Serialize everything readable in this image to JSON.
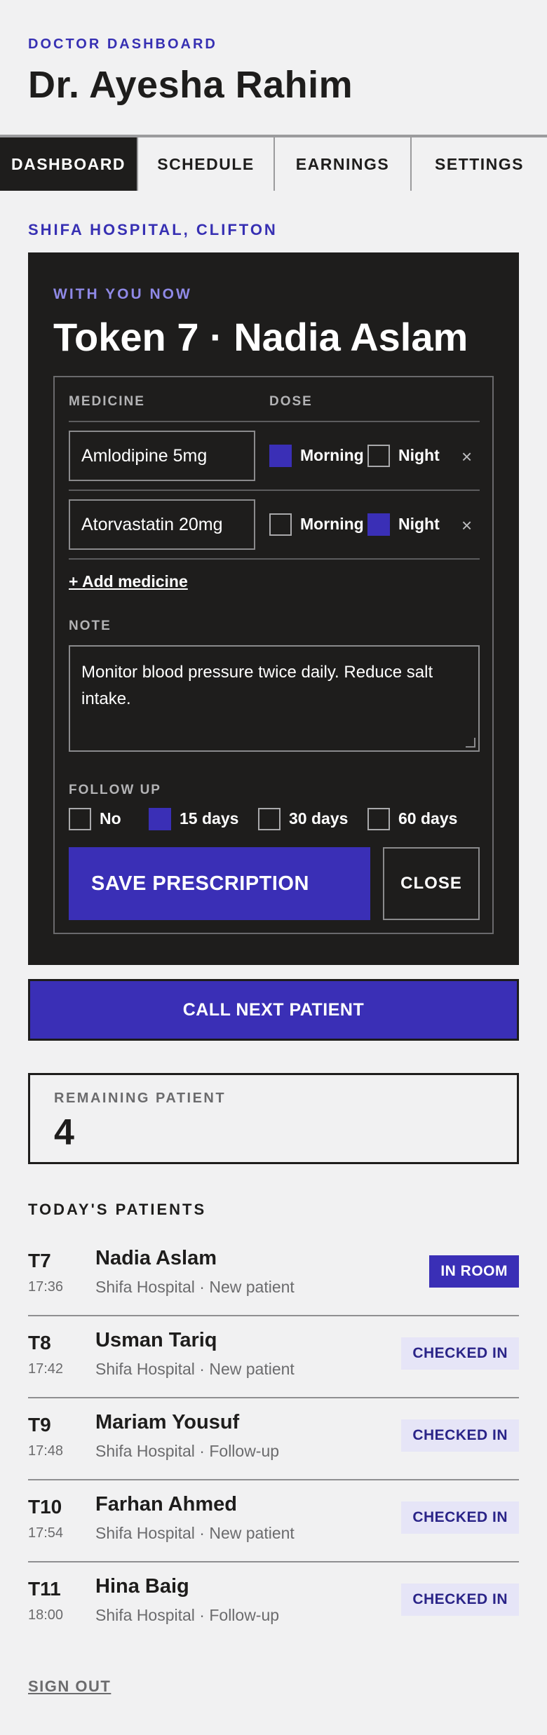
{
  "header": {
    "eyebrow": "DOCTOR DASHBOARD",
    "doctor_name": "Dr. Ayesha Rahim"
  },
  "tabs": [
    {
      "label": "DASHBOARD",
      "active": true
    },
    {
      "label": "SCHEDULE",
      "active": false
    },
    {
      "label": "EARNINGS",
      "active": false
    },
    {
      "label": "SETTINGS",
      "active": false
    }
  ],
  "hospital": "SHIFA HOSPITAL, CLIFTON",
  "consultation": {
    "eyebrow": "WITH YOU NOW",
    "title": "Token 7 · Nadia Aslam",
    "prescription": {
      "medicine_header": "MEDICINE",
      "dose_header": "DOSE",
      "medicines": [
        {
          "name": "Amlodipine 5mg",
          "morning_label": "Morning",
          "morning": true,
          "night_label": "Night",
          "night": false
        },
        {
          "name": "Atorvastatin 20mg",
          "morning_label": "Morning",
          "morning": false,
          "night_label": "Night",
          "night": true
        }
      ],
      "add_medicine": "+ Add medicine",
      "note_label": "NOTE",
      "note": "Monitor blood pressure twice daily. Reduce salt intake.",
      "follow_up_label": "FOLLOW UP",
      "follow_up_options": [
        {
          "label": "No",
          "checked": false
        },
        {
          "label": "15 days",
          "checked": true
        },
        {
          "label": "30 days",
          "checked": false
        },
        {
          "label": "60 days",
          "checked": false
        }
      ],
      "save_label": "SAVE PRESCRIPTION",
      "close_label": "CLOSE"
    }
  },
  "call_next_label": "CALL NEXT PATIENT",
  "remaining": {
    "label": "REMAINING PATIENT",
    "count": "4"
  },
  "patients_title": "TODAY'S PATIENTS",
  "patients": [
    {
      "token": "T7",
      "time": "17:36",
      "name": "Nadia Aslam",
      "meta": "Shifa Hospital · New patient",
      "status": "IN ROOM"
    },
    {
      "token": "T8",
      "time": "17:42",
      "name": "Usman Tariq",
      "meta": "Shifa Hospital · New patient",
      "status": "CHECKED IN"
    },
    {
      "token": "T9",
      "time": "17:48",
      "name": "Mariam Yousuf",
      "meta": "Shifa Hospital · Follow-up",
      "status": "CHECKED IN"
    },
    {
      "token": "T10",
      "time": "17:54",
      "name": "Farhan Ahmed",
      "meta": "Shifa Hospital · New patient",
      "status": "CHECKED IN"
    },
    {
      "token": "T11",
      "time": "18:00",
      "name": "Hina Baig",
      "meta": "Shifa Hospital · Follow-up",
      "status": "CHECKED IN"
    }
  ],
  "sign_out": "SIGN OUT",
  "colors": {
    "accent": "#3a2fb6",
    "dark": "#1e1d1c",
    "background": "#f1f1f2"
  }
}
